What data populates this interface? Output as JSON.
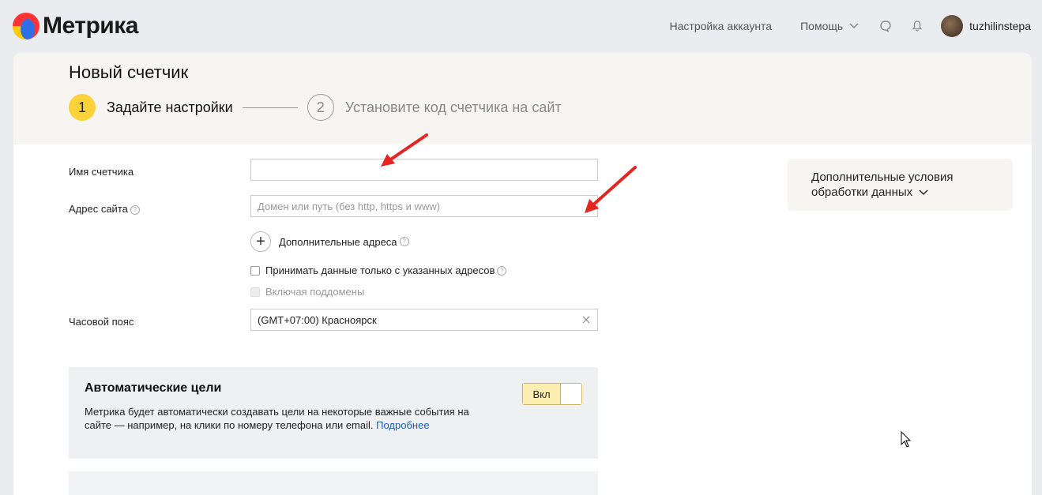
{
  "header": {
    "logo_text": "Метрика",
    "account_settings": "Настройка аккаунта",
    "help": "Помощь",
    "username": "tuzhilinstepa"
  },
  "page": {
    "title": "Новый счетчик",
    "steps": [
      {
        "number": "1",
        "label": "Задайте настройки"
      },
      {
        "number": "2",
        "label": "Установите код счетчика на сайт"
      }
    ]
  },
  "form": {
    "counter_name_label": "Имя счетчика",
    "counter_name_value": "",
    "site_address_label": "Адрес сайта",
    "site_address_placeholder": "Домен или путь (без http, https и www)",
    "additional_addresses": "Дополнительные адреса",
    "accept_only_specified": "Принимать данные только с указанных адресов",
    "include_subdomains": "Включая поддомены",
    "timezone_label": "Часовой пояс",
    "timezone_value": "(GMT+07:00) Красноярск"
  },
  "side_panel": {
    "line1": "Дополнительные условия",
    "line2": "обработки данных"
  },
  "auto_goals": {
    "title": "Автоматические цели",
    "description": "Метрика будет автоматически создавать цели на некоторые важные события на сайте — например, на клики по номеру телефона или email.",
    "more_link": "Подробнее",
    "toggle_label": "Вкл"
  },
  "colors": {
    "accent_yellow": "#fcd23b",
    "annotation_red": "#e52521",
    "link_blue": "#1b5fb5"
  }
}
